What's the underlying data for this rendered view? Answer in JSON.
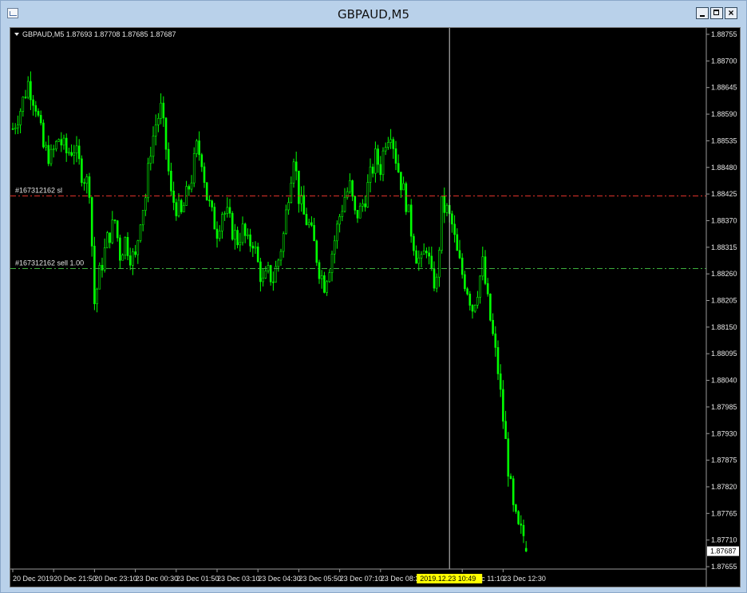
{
  "window": {
    "title": "GBPAUD,M5",
    "icon": "chart-window-icon",
    "controls": {
      "minimize": "minimize-icon",
      "maximize": "maximize-icon",
      "close": "×"
    }
  },
  "header": {
    "symbol_line": "GBPAUD,M5  1.87693 1.87708 1.87685 1.87687"
  },
  "orders": [
    {
      "label": "#167312162 sl",
      "price": 1.88421,
      "color": "#e0322b"
    },
    {
      "label": "#167312162 sell 1.00",
      "price": 1.88271,
      "color": "#3cae3c"
    }
  ],
  "crosshair": {
    "time_label": "2019.12.23 10:49",
    "bar_index": 171
  },
  "current_price_label": "1.87687",
  "colors": {
    "background": "#000000",
    "candles": "#00ff00",
    "axis_text": "#e6e6e6",
    "time_highlight": "#ffff00"
  },
  "chart_data": {
    "type": "candlestick",
    "symbol": "GBPAUD",
    "timeframe": "M5",
    "last_bar": {
      "open": 1.87693,
      "high": 1.87708,
      "low": 1.87685,
      "close": 1.87687
    },
    "ylim": [
      1.87655,
      1.88755
    ],
    "y_ticks": [
      "1.88755",
      "1.88700",
      "1.88645",
      "1.88590",
      "1.88535",
      "1.88480",
      "1.88425",
      "1.88370",
      "1.88315",
      "1.88260",
      "1.88205",
      "1.88150",
      "1.88095",
      "1.88040",
      "1.87985",
      "1.87930",
      "1.87875",
      "1.87820",
      "1.87765",
      "1.87710",
      "1.87655"
    ],
    "x_ticks": [
      {
        "label": "20 Dec 2019",
        "bar": 0
      },
      {
        "label": "20 Dec 21:50",
        "bar": 16
      },
      {
        "label": "20 Dec 23:10",
        "bar": 32
      },
      {
        "label": "23 Dec 00:30",
        "bar": 48
      },
      {
        "label": "23 Dec 01:50",
        "bar": 64
      },
      {
        "label": "23 Dec 03:10",
        "bar": 80
      },
      {
        "label": "23 Dec 04:30",
        "bar": 96
      },
      {
        "label": "23 Dec 05:50",
        "bar": 112
      },
      {
        "label": "23 Dec 07:10",
        "bar": 128
      },
      {
        "label": "23 Dec 08:30",
        "bar": 144
      },
      {
        "label": "23 Dec 11:10",
        "bar": 176
      },
      {
        "label": "23 Dec 12:30",
        "bar": 192
      }
    ],
    "close_path": [
      [
        0,
        1.8856
      ],
      [
        3,
        1.886
      ],
      [
        6,
        1.88655
      ],
      [
        9,
        1.8861
      ],
      [
        12,
        1.8852
      ],
      [
        15,
        1.885
      ],
      [
        18,
        1.8854
      ],
      [
        21,
        1.8851
      ],
      [
        24,
        1.8852
      ],
      [
        27,
        1.8847
      ],
      [
        30,
        1.8844
      ],
      [
        32,
        1.882
      ],
      [
        34,
        1.8826
      ],
      [
        37,
        1.8833
      ],
      [
        40,
        1.8837
      ],
      [
        42,
        1.883
      ],
      [
        44,
        1.8833
      ],
      [
        46,
        1.883
      ],
      [
        48,
        1.8829
      ],
      [
        50,
        1.8838
      ],
      [
        52,
        1.8842
      ],
      [
        54,
        1.8852
      ],
      [
        56,
        1.8857
      ],
      [
        58,
        1.886
      ],
      [
        60,
        1.8852
      ],
      [
        62,
        1.8842
      ],
      [
        64,
        1.884
      ],
      [
        66,
        1.8838
      ],
      [
        68,
        1.8842
      ],
      [
        70,
        1.8846
      ],
      [
        72,
        1.8852
      ],
      [
        74,
        1.885
      ],
      [
        76,
        1.8842
      ],
      [
        78,
        1.8838
      ],
      [
        80,
        1.8835
      ],
      [
        82,
        1.8839
      ],
      [
        84,
        1.8838
      ],
      [
        86,
        1.8835
      ],
      [
        88,
        1.8833
      ],
      [
        90,
        1.8835
      ],
      [
        92,
        1.8832
      ],
      [
        94,
        1.8833
      ],
      [
        96,
        1.8828
      ],
      [
        98,
        1.8824
      ],
      [
        100,
        1.8826
      ],
      [
        102,
        1.8825
      ],
      [
        104,
        1.8829
      ],
      [
        106,
        1.8834
      ],
      [
        108,
        1.8843
      ],
      [
        110,
        1.8851
      ],
      [
        112,
        1.8842
      ],
      [
        114,
        1.8838
      ],
      [
        116,
        1.8836
      ],
      [
        118,
        1.8832
      ],
      [
        120,
        1.8827
      ],
      [
        122,
        1.8824
      ],
      [
        124,
        1.8828
      ],
      [
        126,
        1.8833
      ],
      [
        128,
        1.8838
      ],
      [
        130,
        1.8842
      ],
      [
        132,
        1.8844
      ],
      [
        134,
        1.8838
      ],
      [
        136,
        1.8839
      ],
      [
        138,
        1.8842
      ],
      [
        140,
        1.8846
      ],
      [
        142,
        1.885
      ],
      [
        144,
        1.8848
      ],
      [
        146,
        1.8854
      ],
      [
        148,
        1.8856
      ],
      [
        150,
        1.885
      ],
      [
        152,
        1.8845
      ],
      [
        154,
        1.8841
      ],
      [
        156,
        1.8835
      ],
      [
        158,
        1.883
      ],
      [
        160,
        1.8828
      ],
      [
        162,
        1.8832
      ],
      [
        164,
        1.8825
      ],
      [
        166,
        1.8824
      ],
      [
        168,
        1.884
      ],
      [
        170,
        1.8839
      ],
      [
        172,
        1.8836
      ],
      [
        174,
        1.883
      ],
      [
        176,
        1.8826
      ],
      [
        178,
        1.8823
      ],
      [
        180,
        1.8819
      ],
      [
        182,
        1.8823
      ],
      [
        184,
        1.8828
      ],
      [
        186,
        1.882
      ],
      [
        188,
        1.8813
      ],
      [
        190,
        1.8806
      ],
      [
        192,
        1.8796
      ],
      [
        194,
        1.8786
      ],
      [
        196,
        1.8777
      ],
      [
        198,
        1.8773
      ],
      [
        200,
        1.8772
      ],
      [
        201,
        1.87687
      ]
    ],
    "bar_count": 202
  }
}
